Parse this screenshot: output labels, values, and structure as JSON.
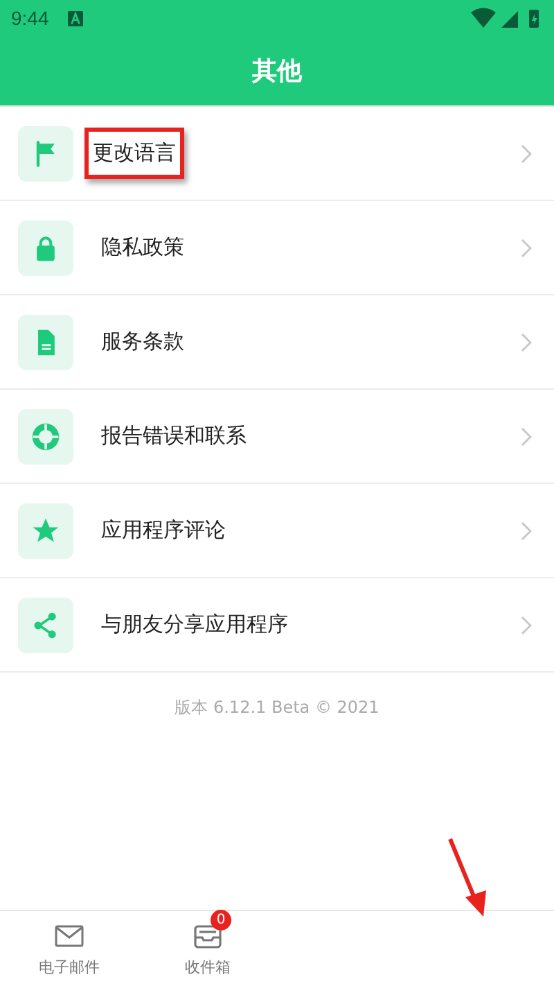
{
  "status_bar": {
    "time": "9:44"
  },
  "header": {
    "title": "其他"
  },
  "menu": [
    {
      "label": "更改语言",
      "highlighted": true
    },
    {
      "label": "隐私政策",
      "highlighted": false
    },
    {
      "label": "服务条款",
      "highlighted": false
    },
    {
      "label": "报告错误和联系",
      "highlighted": false
    },
    {
      "label": "应用程序评论",
      "highlighted": false
    },
    {
      "label": "与朋友分享应用程序",
      "highlighted": false
    }
  ],
  "version": "版本 6.12.1 Beta © 2021",
  "bottom_nav": [
    {
      "label": "电子邮件"
    },
    {
      "label": "收件箱",
      "badge": "0"
    }
  ]
}
